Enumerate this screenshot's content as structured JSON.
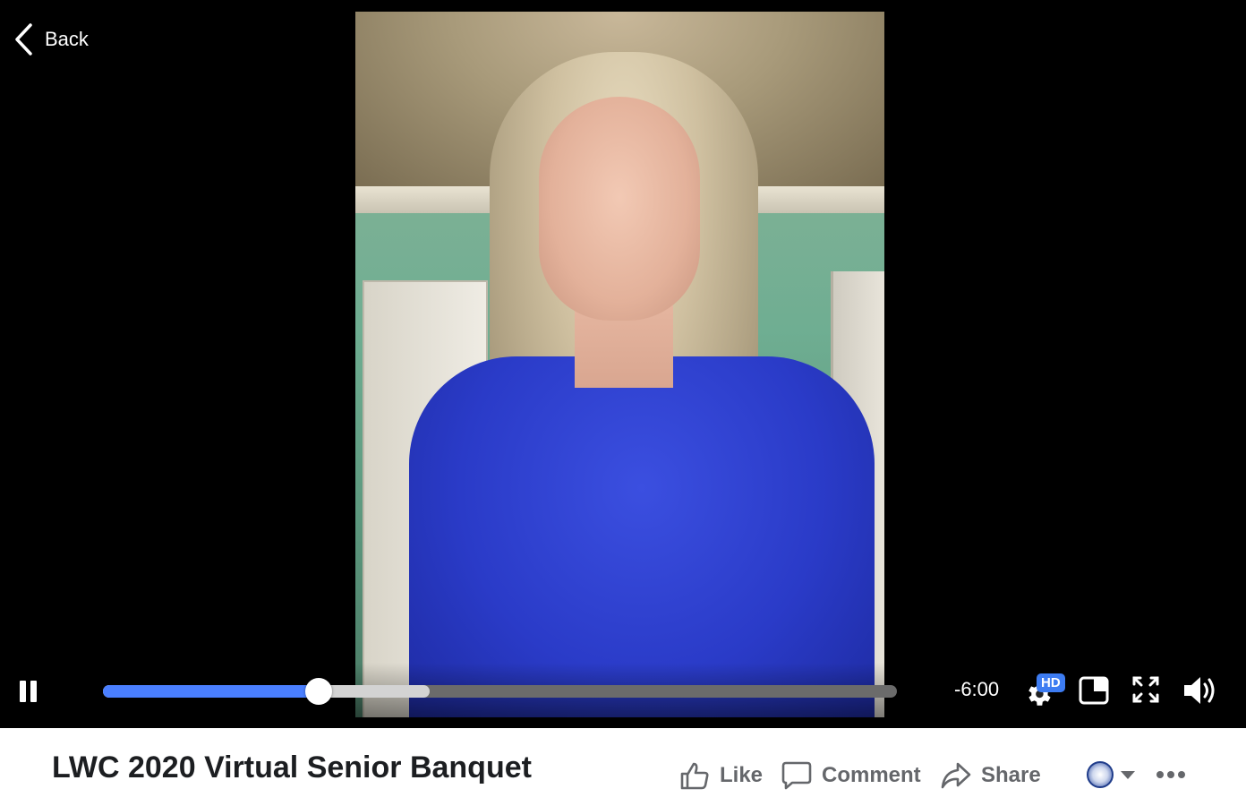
{
  "nav": {
    "back_label": "Back"
  },
  "player": {
    "state": "playing",
    "time_remaining": "-6:00",
    "progress_played": 0.272,
    "progress_buffered": 0.412,
    "quality_badge": "HD",
    "accent_color": "#4a7fff"
  },
  "post": {
    "title": "LWC 2020 Virtual Senior Banquet",
    "actions": {
      "like": "Like",
      "comment": "Comment",
      "share": "Share"
    }
  },
  "icons": [
    "chevron-left-icon",
    "pause-icon",
    "gear-icon",
    "picture-in-picture-icon",
    "fullscreen-icon",
    "volume-icon",
    "thumbs-up-icon",
    "comment-icon",
    "share-arrow-icon",
    "caret-down-icon",
    "more-icon"
  ]
}
